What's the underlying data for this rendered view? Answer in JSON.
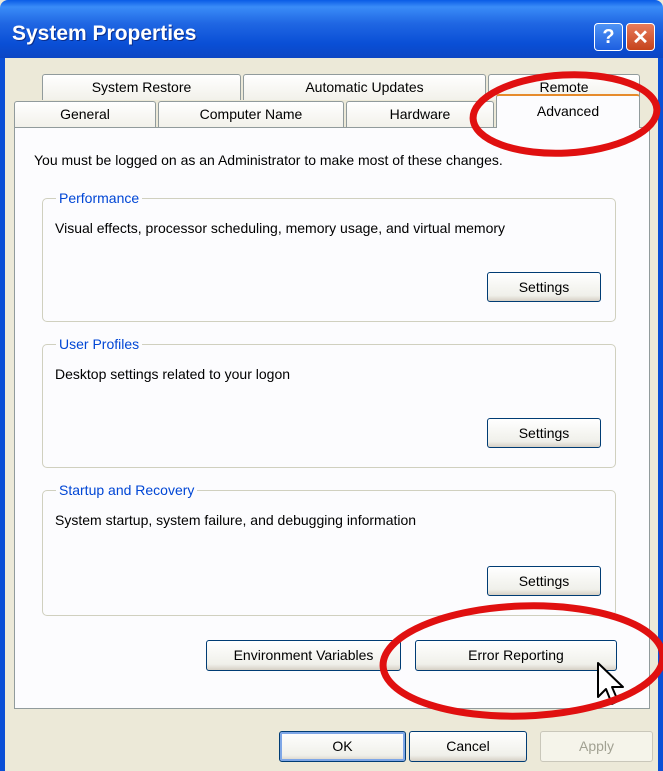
{
  "window": {
    "title": "System Properties",
    "help_label": "?",
    "close_label": "✕"
  },
  "tabs": {
    "row1": [
      "System Restore",
      "Automatic Updates",
      "Remote"
    ],
    "row2": [
      "General",
      "Computer Name",
      "Hardware",
      "Advanced"
    ],
    "active": "Advanced"
  },
  "info_text": "You must be logged on as an Administrator to make most of these changes.",
  "groups": [
    {
      "label": "Performance",
      "description": "Visual effects, processor scheduling, memory usage, and virtual memory",
      "button": "Settings"
    },
    {
      "label": "User Profiles",
      "description": "Desktop settings related to your logon",
      "button": "Settings"
    },
    {
      "label": "Startup and Recovery",
      "description": "System startup, system failure, and debugging information",
      "button": "Settings"
    }
  ],
  "buttons": {
    "environment_variables": "Environment Variables",
    "error_reporting": "Error Reporting",
    "ok": "OK",
    "cancel": "Cancel",
    "apply": "Apply"
  },
  "colors": {
    "title_bar": "#0a4fd6",
    "annotation": "#e01010",
    "group_label": "#0046d5",
    "active_tab_accent": "#e68b2c"
  },
  "icons": {
    "help": "help-icon",
    "close": "close-icon",
    "cursor": "mouse-pointer-icon"
  }
}
